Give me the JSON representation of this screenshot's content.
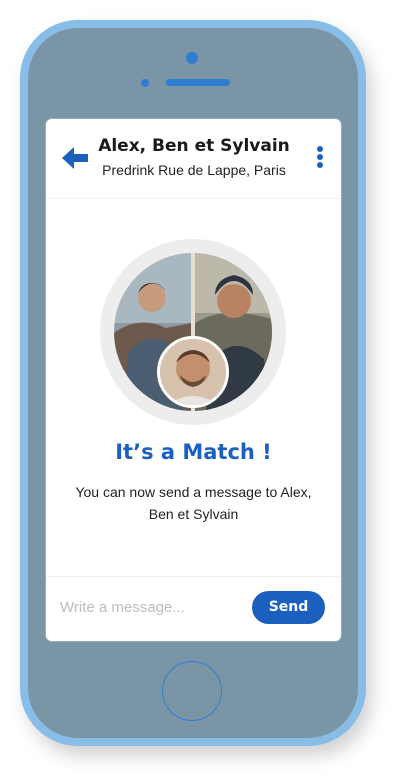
{
  "conversation": {
    "title": "Alex, Ben et Sylvain",
    "subtitle": "Predrink Rue de Lappe, Paris"
  },
  "match": {
    "headline": "It’s a Match !",
    "message": "You can now send a message to Alex, Ben et Sylvain"
  },
  "composer": {
    "placeholder": "Write a message...",
    "send_label": "Send"
  },
  "icons": {
    "back": "arrow-left-icon",
    "menu": "more-vertical-icon"
  },
  "colors": {
    "accent": "#1b5fbf",
    "phone_frame": "#88bde8",
    "phone_body": "#7a96a6"
  }
}
